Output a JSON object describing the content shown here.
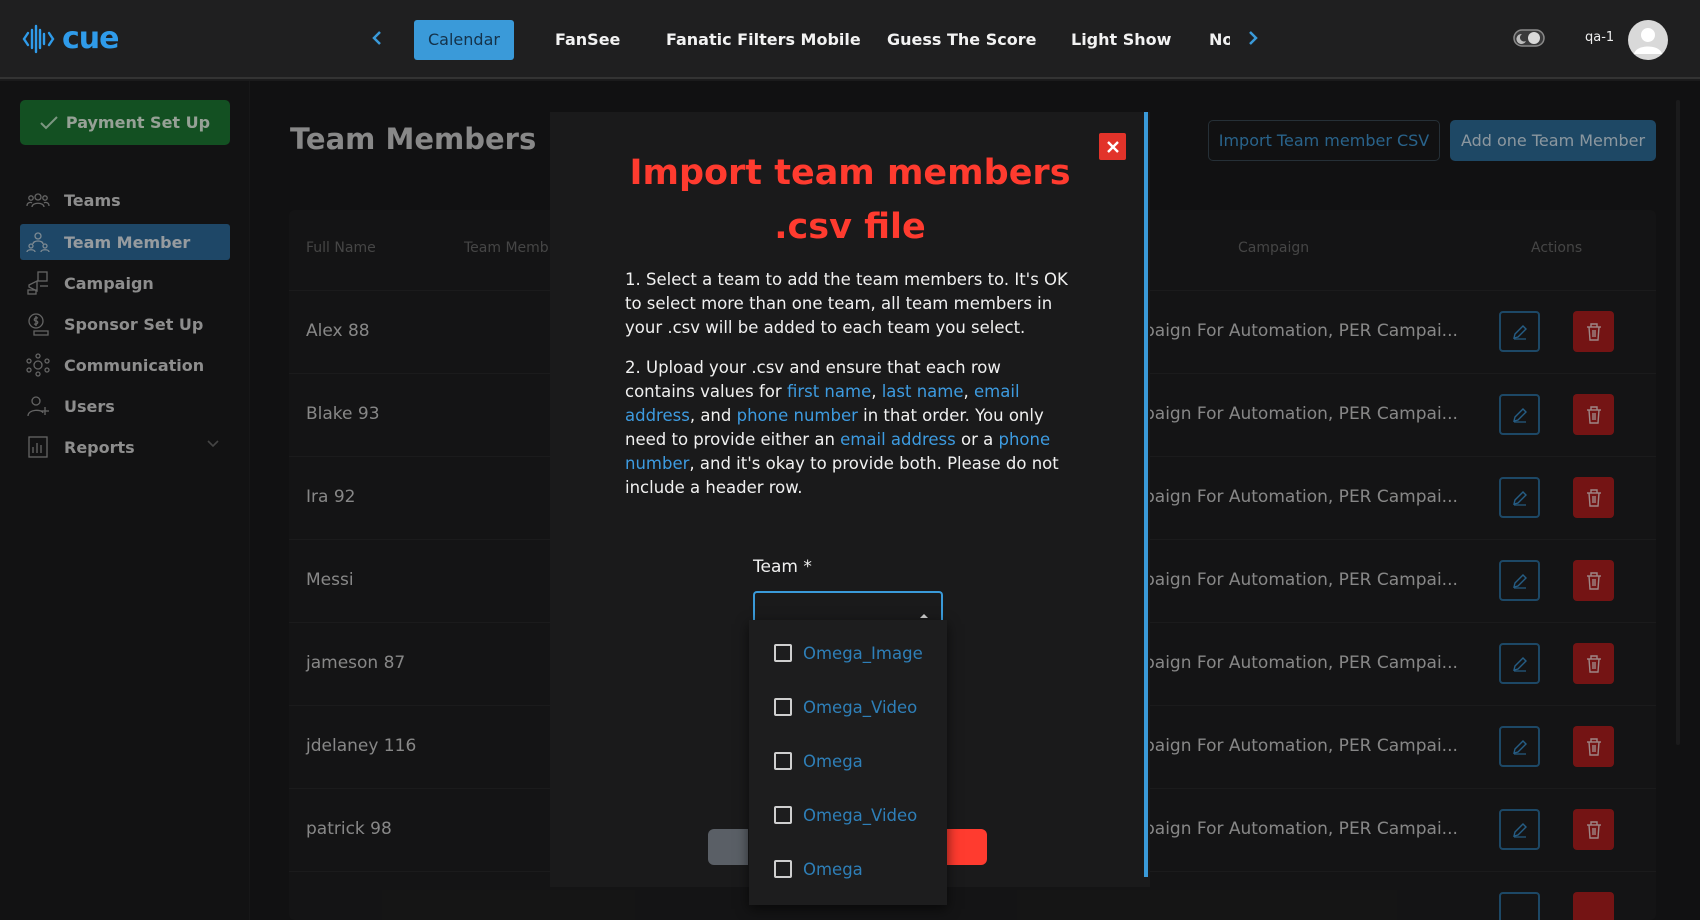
{
  "app": {
    "logo_text": "cue"
  },
  "topnav": {
    "tabs": [
      {
        "label": "Calendar",
        "active": true
      },
      {
        "label": "FanSee"
      },
      {
        "label": "Fanatic Filters Mobile"
      },
      {
        "label": "Guess The Score"
      },
      {
        "label": "Light Show"
      },
      {
        "label": "No"
      }
    ],
    "user_name": "qa-1"
  },
  "sidebar": {
    "payment_button": "Payment Set Up",
    "items": [
      {
        "label": "Teams",
        "icon": "teams-icon"
      },
      {
        "label": "Team Member",
        "icon": "team-member-icon",
        "active": true
      },
      {
        "label": "Campaign",
        "icon": "campaign-icon"
      },
      {
        "label": "Sponsor Set Up",
        "icon": "sponsor-icon"
      },
      {
        "label": "Communication",
        "icon": "communication-icon"
      },
      {
        "label": "Users",
        "icon": "users-icon"
      },
      {
        "label": "Reports",
        "icon": "reports-icon",
        "has_submenu": true
      }
    ]
  },
  "main": {
    "title": "Team Members",
    "import_button": "Import Team member CSV",
    "add_button": "Add one Team Member",
    "table": {
      "headers": {
        "full_name": "Full Name",
        "team_member": "Team Memb",
        "campaign": "Campaign",
        "actions": "Actions"
      },
      "rows": [
        {
          "name": "Alex 88",
          "campaign": "paign For Automation, PER Campai..."
        },
        {
          "name": "Blake 93",
          "campaign": "paign For Automation, PER Campai..."
        },
        {
          "name": "Ira 92",
          "campaign": "paign For Automation, PER Campai..."
        },
        {
          "name": "Messi",
          "campaign": "paign For Automation, PER Campai..."
        },
        {
          "name": "jameson 87",
          "campaign": "paign For Automation, PER Campai..."
        },
        {
          "name": "jdelaney 116",
          "campaign": "paign For Automation, PER Campai..."
        },
        {
          "name": "patrick 98",
          "campaign": "paign For Automation, PER Campai..."
        }
      ]
    }
  },
  "modal": {
    "title_line1": "Import team members",
    "title_line2": ".csv file",
    "p1": "1. Select a team to add the team members to. It's OK to select more than one team, all team members in your .csv will be added to each team you select.",
    "p2": {
      "t1": "2. Upload your .csv and ensure that each row contains values for ",
      "first_name": "first name",
      "t2": ", ",
      "last_name": "last name",
      "t3": ", ",
      "email_address": "email address",
      "t4": ", and ",
      "phone_number": "phone number",
      "t5": " in that order. You only need to provide either an ",
      "email_address_2": "email address",
      "t6": " or a ",
      "phone_number_2": "phone number",
      "t7": ", and it's okay to provide both. Please do not include a header row."
    },
    "team_label": "Team *",
    "options": [
      "Omega_Image",
      "Omega_Video",
      "Omega",
      "Omega_Video",
      "Omega"
    ]
  },
  "colors": {
    "accent": "#3a9ad9",
    "danger": "#e2332a",
    "title_red": "#ff3b2f",
    "success": "#1e7b35"
  }
}
